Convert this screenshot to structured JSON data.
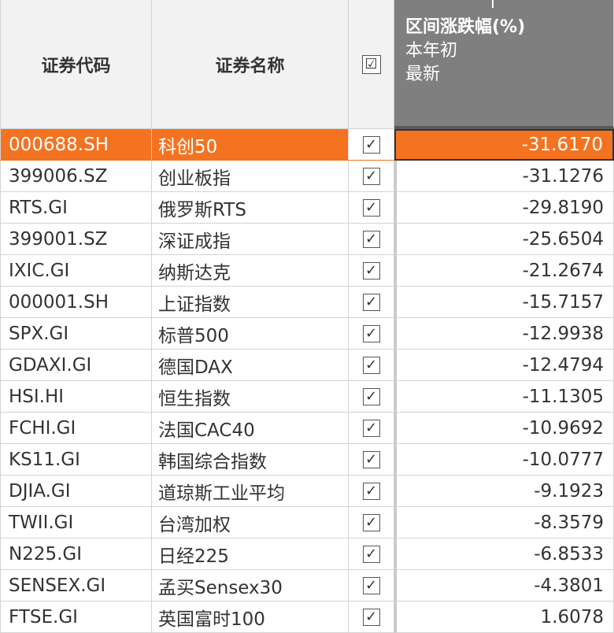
{
  "header": {
    "col_code": "证券代码",
    "col_name": "证券名称",
    "col_check": "☑",
    "col_change_title": "区间涨跌幅(%)",
    "col_change_period": "本年初",
    "col_change_end": "最新"
  },
  "rows": [
    {
      "code": "000688.SH",
      "name": "科创50",
      "value": "-31.6170",
      "checked": true
    },
    {
      "code": "399006.SZ",
      "name": "创业板指",
      "value": "-31.1276",
      "checked": true
    },
    {
      "code": "RTS.GI",
      "name": "俄罗斯RTS",
      "value": "-29.8190",
      "checked": true
    },
    {
      "code": "399001.SZ",
      "name": "深证成指",
      "value": "-25.6504",
      "checked": true
    },
    {
      "code": "IXIC.GI",
      "name": "纳斯达克",
      "value": "-21.2674",
      "checked": true
    },
    {
      "code": "000001.SH",
      "name": "上证指数",
      "value": "-15.7157",
      "checked": true
    },
    {
      "code": "SPX.GI",
      "name": "标普500",
      "value": "-12.9938",
      "checked": true
    },
    {
      "code": "GDAXI.GI",
      "name": "德国DAX",
      "value": "-12.4794",
      "checked": true
    },
    {
      "code": "HSI.HI",
      "name": "恒生指数",
      "value": "-11.1305",
      "checked": true
    },
    {
      "code": "FCHI.GI",
      "name": "法国CAC40",
      "value": "-10.9692",
      "checked": true
    },
    {
      "code": "KS11.GI",
      "name": "韩国综合指数",
      "value": "-10.0777",
      "checked": true
    },
    {
      "code": "DJIA.GI",
      "name": "道琼斯工业平均",
      "value": "-9.1923",
      "checked": true
    },
    {
      "code": "TWII.GI",
      "name": "台湾加权",
      "value": "-8.3579",
      "checked": true
    },
    {
      "code": "N225.GI",
      "name": "日经225",
      "value": "-6.8533",
      "checked": true
    },
    {
      "code": "SENSEX.GI",
      "name": "孟买Sensex30",
      "value": "-4.3801",
      "checked": true
    },
    {
      "code": "FTSE.GI",
      "name": "英国富时100",
      "value": "1.6078",
      "checked": true
    }
  ],
  "selected_row": 0,
  "colors": {
    "accent": "#f47321",
    "header_dark": "#7f7f7f",
    "header_light": "#f2f2f2"
  }
}
